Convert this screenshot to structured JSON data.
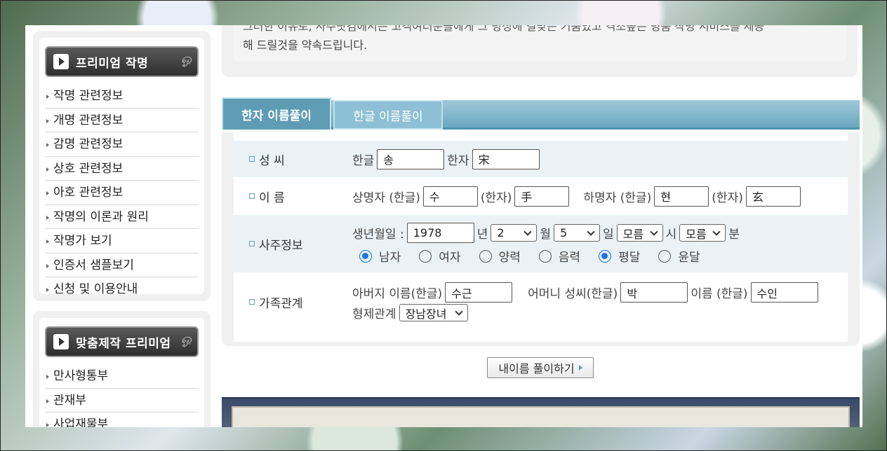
{
  "sidebar": {
    "premium": {
      "title": "프리미엄 작명",
      "items": [
        "작명 관련정보",
        "개명 관련정보",
        "감명 관련정보",
        "상호 관련정보",
        "아호 관련정보",
        "작명의 이론과 원리",
        "작명가 보기",
        "인증서 샘플보기",
        "신청 및 이용안내"
      ]
    },
    "custom": {
      "title": "맞춤제작 프리미엄",
      "items": [
        "만사형통부",
        "관재부",
        "사업재물부"
      ]
    }
  },
  "intro": {
    "line1": "그러한 이유로, 사주닷컴에서는 고객여러분들에게 그 명성에 걸맞는 기품있고 격조높은 명품 작명 서비스를 제공",
    "line2": "해 드릴것을 약속드립니다."
  },
  "tabs": {
    "hanja": "한자 이름풀이",
    "hangul": "한글 이름풀이"
  },
  "form": {
    "surname": {
      "label": "성 씨",
      "hangul_label": "한글",
      "hangul_value": "송",
      "hanja_label": "한자",
      "hanja_value": "宋"
    },
    "name": {
      "label": "이 름",
      "upper_hangul_label": "상명자 (한글)",
      "upper_hangul_value": "수",
      "upper_hanja_label": "(한자)",
      "upper_hanja_value": "手",
      "lower_hangul_label": "하명자 (한글)",
      "lower_hangul_value": "현",
      "lower_hanja_label": "(한자)",
      "lower_hanja_value": "玄"
    },
    "saju": {
      "label": "사주정보",
      "birth_label": "생년월일 :",
      "year_value": "1978",
      "year_unit": "년",
      "month_value": "2",
      "month_unit": "월",
      "day_value": "5",
      "day_unit": "일",
      "hour_value": "모름",
      "hour_unit": "시",
      "minute_value": "모름",
      "minute_unit": "분",
      "gender_male": "남자",
      "gender_female": "여자",
      "cal_solar": "양력",
      "cal_lunar": "음력",
      "leap_normal": "평달",
      "leap_leap": "윤달"
    },
    "family": {
      "label": "가족관계",
      "father_label": "아버지 이름(한글)",
      "father_value": "수근",
      "mother_surname_label": "어머니 성씨(한글)",
      "mother_surname_value": "박",
      "mother_name_label": "이름 (한글)",
      "mother_name_value": "수인",
      "sibling_label": "형제관계",
      "sibling_value": "장남장녀"
    }
  },
  "submit": {
    "label": "내이름 풀이하기"
  },
  "colors": {
    "tab_blue": "#6aa8c0",
    "radio_blue": "#1a73e8"
  }
}
